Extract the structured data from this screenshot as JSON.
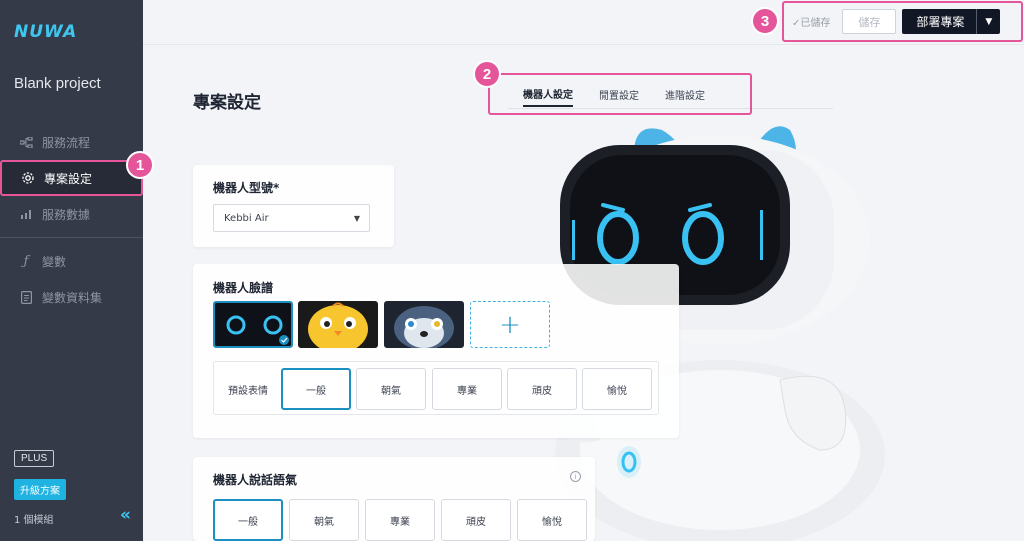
{
  "app": {
    "logo": "NUWA",
    "project_name": "Blank project"
  },
  "sidebar": {
    "items": [
      {
        "label": "服務流程",
        "icon": "flow-icon"
      },
      {
        "label": "專案設定",
        "icon": "gear-icon",
        "active": true
      },
      {
        "label": "服務數據",
        "icon": "chart-icon"
      },
      {
        "label": "變數",
        "icon": "function-icon"
      },
      {
        "label": "變數資料集",
        "icon": "document-icon"
      }
    ],
    "plan_badge": "PLUS",
    "upgrade_label": "升級方案",
    "module_count": "1 個模組"
  },
  "markers": [
    "1",
    "2",
    "3"
  ],
  "topbar": {
    "saved_label": "✓已儲存",
    "save_label": "儲存",
    "deploy_label": "部署專案"
  },
  "page": {
    "title": "專案設定"
  },
  "tabs": [
    {
      "label": "機器人設定",
      "active": true
    },
    {
      "label": "閒置設定"
    },
    {
      "label": "進階設定"
    }
  ],
  "robot_model": {
    "title": "機器人型號*",
    "value": "Kebbi Air"
  },
  "robot_face": {
    "title": "機器人臉譜",
    "add_label": "+",
    "expression_label": "預設表情",
    "expressions": [
      "一般",
      "朝氣",
      "專業",
      "頑皮",
      "愉悅"
    ],
    "selected_expression": "一般"
  },
  "robot_tone": {
    "title": "機器人說話語氣",
    "info_icon": "i",
    "tones": [
      "一般",
      "朝氣",
      "專業",
      "頑皮",
      "愉悅"
    ],
    "selected_tone": "一般"
  },
  "colors": {
    "accent": "#1b8fc0",
    "highlight": "#e5559a",
    "sidebar": "#343a48",
    "logo": "#3fc6ef"
  }
}
